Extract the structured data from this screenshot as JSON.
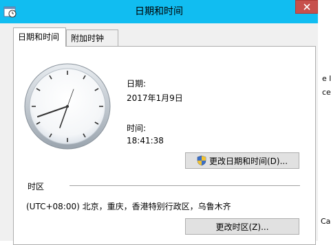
{
  "window": {
    "title": "日期和时间",
    "close_glyph": "×"
  },
  "tabs": [
    {
      "label": "日期和时间",
      "active": true
    },
    {
      "label": "附加时钟",
      "active": false
    }
  ],
  "date_section": {
    "date_label": "日期:",
    "date_value": "2017年1月9日",
    "time_label": "时间:",
    "time_value": "18:41:38",
    "change_button_label": "更改日期和时间(D)..."
  },
  "timezone_section": {
    "heading": "时区",
    "value": "(UTC+08:00) 北京，重庆，香港特别行政区，乌鲁木齐",
    "change_button_label": "更改时区(Z)..."
  },
  "background_window": {
    "fragment_1": "e l",
    "fragment_2": "ce",
    "fragment_3": "Ca"
  },
  "colors": {
    "titlebar": "#11bdf1",
    "close_button": "#c7504c",
    "dialog_bg": "#f0f0f0",
    "panel_bg": "#ffffff"
  },
  "icons": {
    "title": "clock-icon",
    "close": "close-icon",
    "uac": "uac-shield-icon"
  }
}
